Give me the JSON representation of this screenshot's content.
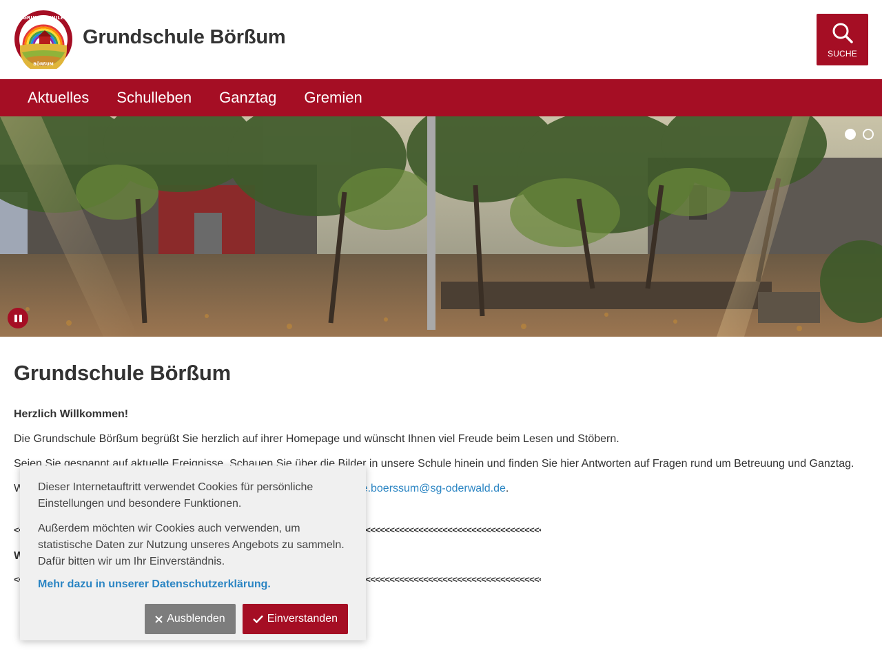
{
  "header": {
    "site_title": "Grundschule Börßum",
    "logo_text_top": "GRUNDSCHULE",
    "logo_text_bottom": "BÖRßUM",
    "search_label": "SUCHE"
  },
  "nav": {
    "items": [
      {
        "label": "Aktuelles"
      },
      {
        "label": "Schulleben"
      },
      {
        "label": "Ganztag"
      },
      {
        "label": "Gremien"
      }
    ]
  },
  "slider": {
    "slide_count": 2,
    "active_slide": 1
  },
  "main": {
    "page_title": "Grundschule Börßum",
    "welcome": "Herzlich Willkommen!",
    "paragraph1": "Die Grundschule Börßum begrüßt Sie herzlich auf ihrer Homepage und wünscht Ihnen viel Freude beim Lesen und Stöbern.",
    "paragraph2": "Seien Sie gespannt auf aktuelle Ereignisse. Schauen Sie über die Bilder in unsere Schule hinein und finden Sie hier Antworten auf Fragen rund um Betreuung und Ganztag.",
    "paragraph3_start": "W",
    "email_visible": "le.boerssum@sg-oderwald.de",
    "paragraph3_end": ".",
    "arrow_line": "<<<<<<<<<<<<<<<<<<<<<<<<<<<<<<<<<<<<<<<<<<<<<<<<<<<<<<<<<<<<<<<<<<<<<<<<<<<<<<<<<<<<<<<<<<<<<<<<<<<<<<<<<<<<<<<<<<<<<<<<<<<<<<<<<<<<<<<<<<<<<<<<<<<",
    "partial_w": "W"
  },
  "cookie_banner": {
    "text1": "Dieser Internetauftritt verwendet Cookies für persönliche Einstellungen und besondere Funktionen.",
    "text2": "Außerdem möchten wir Cookies auch verwenden, um statistische Daten zur Nutzung unseres Angebots zu sammeln. Dafür bitten wir um Ihr Einverständnis.",
    "privacy_link": "Mehr dazu in unserer Datenschutzerklärung.",
    "dismiss_label": "Ausblenden",
    "accept_label": "Einverstanden"
  },
  "colors": {
    "brand": "#a50e24",
    "link": "#2b85c3",
    "banner_bg": "#f0f0f0",
    "dismiss_bg": "#7d7d7d"
  },
  "icons": {
    "search": "magnifier-icon",
    "pause": "pause-icon",
    "dismiss": "close-icon",
    "accept": "checkmark-icon"
  }
}
